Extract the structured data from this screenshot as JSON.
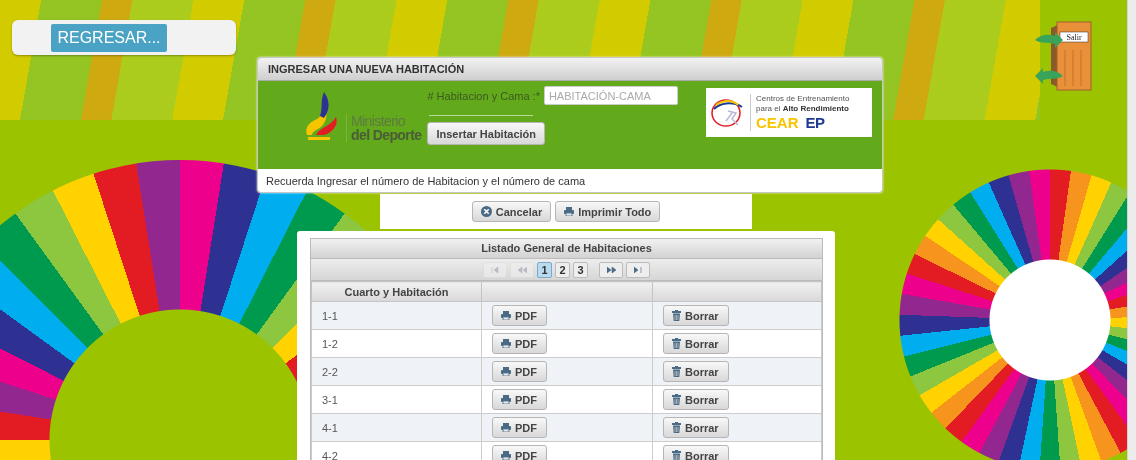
{
  "back_button": {
    "label": "REGRESAR..."
  },
  "exit_icon": {
    "label": "Salir"
  },
  "form_panel": {
    "title": "INGRESAR UNA NUEVA HABITACIÓN",
    "logo_left": {
      "line1": "Ministerio",
      "line2": "del Deporte"
    },
    "field_label": "# Habitacion y Cama :*",
    "field_placeholder": "HABITACIÓN-CAMA",
    "submit_button": "Insertar Habitación",
    "logo_right": {
      "line1": "Centros de Entrenamiento",
      "line2": "para el **Alto Rendimiento**",
      "brand_1": "CEAR",
      "brand_2": "EP"
    },
    "hint": "Recuerda Ingresar el número de Habitacion y el número de cama"
  },
  "actions": [
    {
      "label": "Cancelar",
      "kind": "cancel"
    },
    {
      "label": "Imprimir Todo",
      "kind": "print"
    }
  ],
  "table": {
    "title": "Listado General de Habitaciones",
    "pager": [
      {
        "kind": "first",
        "disabled": true
      },
      {
        "kind": "prev",
        "disabled": true
      },
      {
        "kind": "page",
        "label": "1",
        "selected": true
      },
      {
        "kind": "page",
        "label": "2",
        "selected": false
      },
      {
        "kind": "page",
        "label": "3",
        "selected": false
      },
      {
        "kind": "next",
        "disabled": false
      },
      {
        "kind": "last",
        "disabled": false
      }
    ],
    "columns": [
      "Cuarto y Habitación"
    ],
    "rows": [
      {
        "room": "1-1",
        "pdf": "PDF",
        "delete": "Borrar"
      },
      {
        "room": "1-2",
        "pdf": "PDF",
        "delete": "Borrar"
      },
      {
        "room": "2-2",
        "pdf": "PDF",
        "delete": "Borrar"
      },
      {
        "room": "3-1",
        "pdf": "PDF",
        "delete": "Borrar"
      },
      {
        "room": "4-1",
        "pdf": "PDF",
        "delete": "Borrar"
      },
      {
        "room": "4-2",
        "pdf": "PDF",
        "delete": "Borrar"
      }
    ]
  }
}
